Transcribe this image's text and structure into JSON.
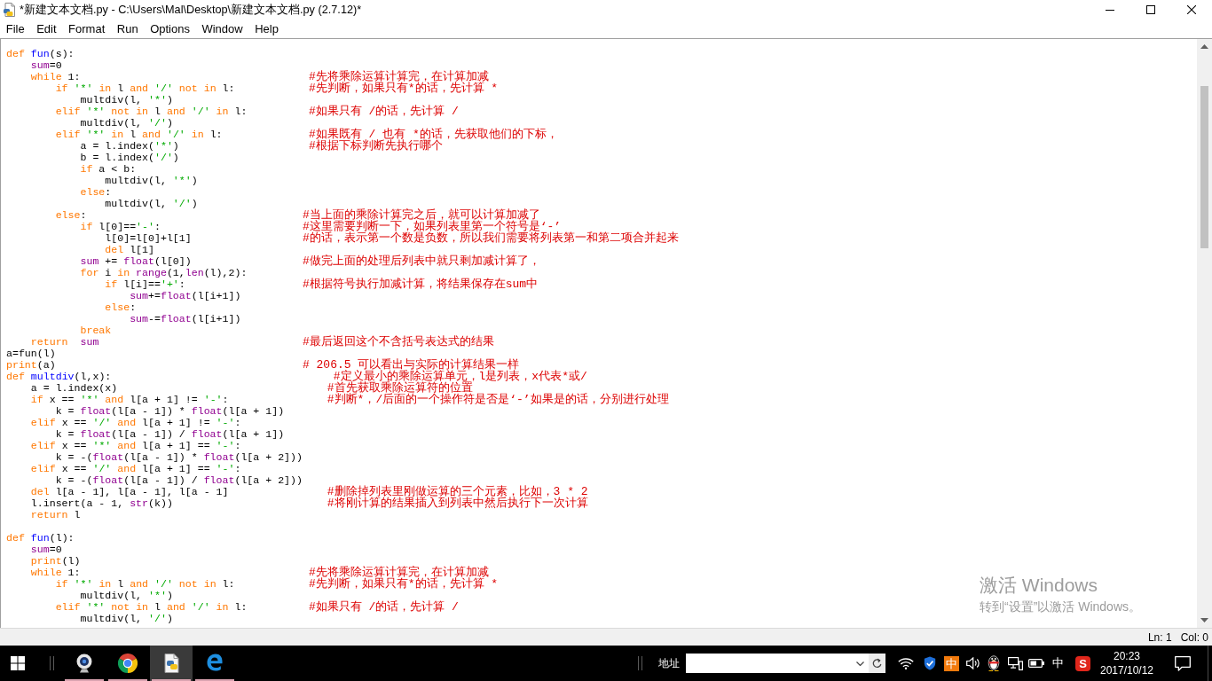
{
  "window": {
    "title": "*新建文本文档.py - C:\\Users\\Mal\\Desktop\\新建文本文档.py (2.7.12)*"
  },
  "menu": [
    "File",
    "Edit",
    "Format",
    "Run",
    "Options",
    "Window",
    "Help"
  ],
  "editor": {
    "lines": [
      {
        "kind": "code",
        "tokens": [
          {
            "kind": "keyword",
            "text": "def "
          },
          {
            "kind": "definition",
            "text": "fun"
          },
          {
            "kind": "plain",
            "text": "(s):"
          }
        ],
        "children": [
          {
            "tokens": [
              {
                "kind": "builtin",
                "text": "sum"
              },
              {
                "kind": "plain",
                "text": "=0"
              }
            ]
          },
          {
            "tokens": [
              {
                "kind": "keyword",
                "text": "while"
              },
              {
                "kind": "plain",
                "text": " 1:"
              }
            ],
            "comment": "#先将乘除运算计算完，在计算加减",
            "children": [
              {
                "tokens": [
                  {
                    "kind": "keyword",
                    "text": "if "
                  },
                  {
                    "kind": "string",
                    "text": "'*' "
                  },
                  {
                    "kind": "keyword",
                    "text": "in"
                  },
                  {
                    "kind": "plain",
                    "text": " l "
                  },
                  {
                    "kind": "keyword",
                    "text": "and "
                  },
                  {
                    "kind": "string",
                    "text": "'/' "
                  },
                  {
                    "kind": "keyword",
                    "text": "not in"
                  },
                  {
                    "kind": "plain",
                    "text": " l:"
                  }
                ],
                "comment": "#先判断，如果只有*的话，先计算 *",
                "children": [
                  {
                    "tokens": [
                      {
                        "kind": "plain",
                        "text": "multdiv(l, "
                      },
                      {
                        "kind": "string",
                        "text": "'*'"
                      },
                      {
                        "kind": "plain",
                        "text": ")"
                      }
                    ]
                  }
                ]
              },
              {
                "tokens": [
                  {
                    "kind": "keyword",
                    "text": "elif "
                  },
                  {
                    "kind": "string",
                    "text": "'*' "
                  },
                  {
                    "kind": "keyword",
                    "text": "not in"
                  },
                  {
                    "kind": "plain",
                    "text": " l "
                  },
                  {
                    "kind": "keyword",
                    "text": "and "
                  },
                  {
                    "kind": "string",
                    "text": "'/' "
                  },
                  {
                    "kind": "keyword",
                    "text": "in"
                  },
                  {
                    "kind": "plain",
                    "text": " l:"
                  }
                ],
                "comment": "#如果只有 /的话，先计算 /",
                "children": [
                  {
                    "tokens": [
                      {
                        "kind": "plain",
                        "text": "multdiv(l, "
                      },
                      {
                        "kind": "string",
                        "text": "'/'"
                      },
                      {
                        "kind": "plain",
                        "text": ")"
                      }
                    ]
                  }
                ]
              },
              {
                "tokens": [
                  {
                    "kind": "keyword",
                    "text": "elif "
                  },
                  {
                    "kind": "string",
                    "text": "'*' "
                  },
                  {
                    "kind": "keyword",
                    "text": "in"
                  },
                  {
                    "kind": "plain",
                    "text": " l "
                  },
                  {
                    "kind": "keyword",
                    "text": "and "
                  },
                  {
                    "kind": "string",
                    "text": "'/' "
                  },
                  {
                    "kind": "keyword",
                    "text": "in"
                  },
                  {
                    "kind": "plain",
                    "text": " l:"
                  }
                ],
                "comment": "#如果既有 / 也有 *的话，先获取他们的下标，",
                "children": [
                  {
                    "tokens": [
                      {
                        "kind": "plain",
                        "text": "a = l.index("
                      },
                      {
                        "kind": "string",
                        "text": "'*'"
                      },
                      {
                        "kind": "plain",
                        "text": ")"
                      }
                    ],
                    "comment": "#根据下标判断先执行哪个"
                  },
                  {
                    "tokens": [
                      {
                        "kind": "plain",
                        "text": "b = l.index("
                      },
                      {
                        "kind": "string",
                        "text": "'/'"
                      },
                      {
                        "kind": "plain",
                        "text": ")"
                      }
                    ]
                  },
                  {
                    "tokens": [
                      {
                        "kind": "keyword",
                        "text": "if"
                      },
                      {
                        "kind": "plain",
                        "text": " a < b:"
                      }
                    ],
                    "children": [
                      {
                        "tokens": [
                          {
                            "kind": "plain",
                            "text": "multdiv(l, "
                          },
                          {
                            "kind": "string",
                            "text": "'*'"
                          },
                          {
                            "kind": "plain",
                            "text": ")"
                          }
                        ]
                      }
                    ]
                  },
                  {
                    "tokens": [
                      {
                        "kind": "keyword",
                        "text": "else"
                      },
                      {
                        "kind": "plain",
                        "text": ":"
                      }
                    ],
                    "children": [
                      {
                        "tokens": [
                          {
                            "kind": "plain",
                            "text": "multdiv(l, "
                          },
                          {
                            "kind": "string",
                            "text": "'/'"
                          },
                          {
                            "kind": "plain",
                            "text": ")"
                          }
                        ]
                      }
                    ]
                  }
                ]
              },
              {
                "tokens": [
                  {
                    "kind": "keyword",
                    "text": "else"
                  },
                  {
                    "kind": "plain",
                    "text": ":"
                  }
                ],
                "comment": "#当上面的乘除计算完之后，就可以计算加减了",
                "children": [
                  {
                    "tokens": [
                      {
                        "kind": "keyword",
                        "text": "if"
                      },
                      {
                        "kind": "plain",
                        "text": " l[0]=="
                      },
                      {
                        "kind": "string",
                        "text": "'-'"
                      },
                      {
                        "kind": "plain",
                        "text": ":"
                      }
                    ],
                    "comment": "#这里需要判断一下，如果列表里第一个符号是‘-’",
                    "children": [
                      {
                        "tokens": [
                          {
                            "kind": "plain",
                            "text": "l[0]=l[0]+l[1]"
                          }
                        ],
                        "comment": "#的话，表示第一个数是负数，所以我们需要将列表第一和第二项合并起来"
                      },
                      {
                        "tokens": [
                          {
                            "kind": "keyword",
                            "text": "del"
                          },
                          {
                            "kind": "plain",
                            "text": " l[1]"
                          }
                        ]
                      }
                    ]
                  },
                  {
                    "tokens": [
                      {
                        "kind": "builtin",
                        "text": "sum"
                      },
                      {
                        "kind": "plain",
                        "text": " += "
                      },
                      {
                        "kind": "builtin",
                        "text": "float"
                      },
                      {
                        "kind": "plain",
                        "text": "(l[0])"
                      }
                    ],
                    "comment": "#做完上面的处理后列表中就只剩加减计算了，"
                  },
                  {
                    "tokens": [
                      {
                        "kind": "keyword",
                        "text": "for"
                      },
                      {
                        "kind": "plain",
                        "text": " i "
                      },
                      {
                        "kind": "keyword",
                        "text": "in "
                      },
                      {
                        "kind": "builtin",
                        "text": "range"
                      },
                      {
                        "kind": "plain",
                        "text": "(1,"
                      },
                      {
                        "kind": "builtin",
                        "text": "len"
                      },
                      {
                        "kind": "plain",
                        "text": "(l),2):"
                      }
                    ],
                    "children": [
                      {
                        "tokens": [
                          {
                            "kind": "keyword",
                            "text": "if"
                          },
                          {
                            "kind": "plain",
                            "text": " l[i]=="
                          },
                          {
                            "kind": "string",
                            "text": "'+'"
                          },
                          {
                            "kind": "plain",
                            "text": ":"
                          }
                        ],
                        "comment": "#根据符号执行加减计算，将结果保存在sum中",
                        "children": [
                          {
                            "tokens": [
                              {
                                "kind": "builtin",
                                "text": "sum"
                              },
                              {
                                "kind": "plain",
                                "text": "+="
                              },
                              {
                                "kind": "builtin",
                                "text": "float"
                              },
                              {
                                "kind": "plain",
                                "text": "(l[i+1])"
                              }
                            ]
                          }
                        ]
                      },
                      {
                        "tokens": [
                          {
                            "kind": "keyword",
                            "text": "else"
                          },
                          {
                            "kind": "plain",
                            "text": ":"
                          }
                        ],
                        "children": [
                          {
                            "tokens": [
                              {
                                "kind": "builtin",
                                "text": "sum"
                              },
                              {
                                "kind": "plain",
                                "text": "-="
                              },
                              {
                                "kind": "builtin",
                                "text": "float"
                              },
                              {
                                "kind": "plain",
                                "text": "(l[i+1])"
                              }
                            ]
                          }
                        ]
                      }
                    ]
                  },
                  {
                    "tokens": [
                      {
                        "kind": "keyword",
                        "text": "break"
                      }
                    ]
                  }
                ]
              }
            ]
          },
          {
            "tokens": [
              {
                "kind": "keyword",
                "text": "return  "
              },
              {
                "kind": "builtin",
                "text": "sum"
              }
            ],
            "comment": "#最后返回这个不含括号表达式的结果"
          }
        ]
      },
      {
        "kind": "code",
        "tokens": [
          {
            "kind": "plain",
            "text": "a=fun(l)"
          }
        ]
      },
      {
        "kind": "code",
        "tokens": [
          {
            "kind": "keyword",
            "text": "print"
          },
          {
            "kind": "plain",
            "text": "(a)"
          }
        ],
        "comment": "# 206.5 可以看出与实际的计算结果一样"
      },
      {
        "kind": "code",
        "tokens": [
          {
            "kind": "keyword",
            "text": "def "
          },
          {
            "kind": "definition",
            "text": "multdiv"
          },
          {
            "kind": "plain",
            "text": "(l,x):"
          }
        ],
        "comment": "#定义最小的乘除运算单元，l是列表，x代表*或/",
        "children": [
          {
            "tokens": [
              {
                "kind": "plain",
                "text": "a = l.index(x)"
              }
            ],
            "comment": "#首先获取乘除运算符的位置"
          },
          {
            "tokens": [
              {
                "kind": "keyword",
                "text": "if"
              },
              {
                "kind": "plain",
                "text": " x == "
              },
              {
                "kind": "string",
                "text": "'*' "
              },
              {
                "kind": "keyword",
                "text": "and"
              },
              {
                "kind": "plain",
                "text": " l[a + 1] != "
              },
              {
                "kind": "string",
                "text": "'-'"
              },
              {
                "kind": "plain",
                "text": ":"
              }
            ],
            "comment": "#判断*，/后面的一个操作符是否是‘-’如果是的话，分别进行处理",
            "children": [
              {
                "tokens": [
                  {
                    "kind": "plain",
                    "text": "k = "
                  },
                  {
                    "kind": "builtin",
                    "text": "float"
                  },
                  {
                    "kind": "plain",
                    "text": "(l[a - 1]) * "
                  },
                  {
                    "kind": "builtin",
                    "text": "float"
                  },
                  {
                    "kind": "plain",
                    "text": "(l[a + 1])"
                  }
                ]
              }
            ]
          },
          {
            "tokens": [
              {
                "kind": "keyword",
                "text": "elif"
              },
              {
                "kind": "plain",
                "text": " x == "
              },
              {
                "kind": "string",
                "text": "'/' "
              },
              {
                "kind": "keyword",
                "text": "and"
              },
              {
                "kind": "plain",
                "text": " l[a + 1] != "
              },
              {
                "kind": "string",
                "text": "'-'"
              },
              {
                "kind": "plain",
                "text": ":"
              }
            ],
            "children": [
              {
                "tokens": [
                  {
                    "kind": "plain",
                    "text": "k = "
                  },
                  {
                    "kind": "builtin",
                    "text": "float"
                  },
                  {
                    "kind": "plain",
                    "text": "(l[a - 1]) / "
                  },
                  {
                    "kind": "builtin",
                    "text": "float"
                  },
                  {
                    "kind": "plain",
                    "text": "(l[a + 1])"
                  }
                ]
              }
            ]
          },
          {
            "tokens": [
              {
                "kind": "keyword",
                "text": "elif"
              },
              {
                "kind": "plain",
                "text": " x == "
              },
              {
                "kind": "string",
                "text": "'*' "
              },
              {
                "kind": "keyword",
                "text": "and"
              },
              {
                "kind": "plain",
                "text": " l[a + 1] == "
              },
              {
                "kind": "string",
                "text": "'-'"
              },
              {
                "kind": "plain",
                "text": ":"
              }
            ],
            "children": [
              {
                "tokens": [
                  {
                    "kind": "plain",
                    "text": "k = -("
                  },
                  {
                    "kind": "builtin",
                    "text": "float"
                  },
                  {
                    "kind": "plain",
                    "text": "(l[a - 1]) * "
                  },
                  {
                    "kind": "builtin",
                    "text": "float"
                  },
                  {
                    "kind": "plain",
                    "text": "(l[a + 2]))"
                  }
                ]
              }
            ]
          },
          {
            "tokens": [
              {
                "kind": "keyword",
                "text": "elif"
              },
              {
                "kind": "plain",
                "text": " x == "
              },
              {
                "kind": "string",
                "text": "'/' "
              },
              {
                "kind": "keyword",
                "text": "and"
              },
              {
                "kind": "plain",
                "text": " l[a + 1] == "
              },
              {
                "kind": "string",
                "text": "'-'"
              },
              {
                "kind": "plain",
                "text": ":"
              }
            ],
            "children": [
              {
                "tokens": [
                  {
                    "kind": "plain",
                    "text": "k = -("
                  },
                  {
                    "kind": "builtin",
                    "text": "float"
                  },
                  {
                    "kind": "plain",
                    "text": "(l[a - 1]) / "
                  },
                  {
                    "kind": "builtin",
                    "text": "float"
                  },
                  {
                    "kind": "plain",
                    "text": "(l[a + 2]))"
                  }
                ]
              }
            ]
          },
          {
            "tokens": [
              {
                "kind": "keyword",
                "text": "del"
              },
              {
                "kind": "plain",
                "text": " l[a - 1], l[a - 1], l[a - 1]"
              }
            ],
            "comment": "#删除掉列表里刚做运算的三个元素，比如，3 * 2"
          },
          {
            "tokens": [
              {
                "kind": "plain",
                "text": "l.insert(a - 1, "
              },
              {
                "kind": "builtin",
                "text": "str"
              },
              {
                "kind": "plain",
                "text": "(k))"
              }
            ],
            "comment": "#将刚计算的结果插入到列表中然后执行下一次计算"
          },
          {
            "tokens": [
              {
                "kind": "keyword",
                "text": "return"
              },
              {
                "kind": "plain",
                "text": " l"
              }
            ]
          }
        ]
      },
      {
        "kind": "blank"
      },
      {
        "kind": "code",
        "tokens": [
          {
            "kind": "keyword",
            "text": "def "
          },
          {
            "kind": "definition",
            "text": "fun"
          },
          {
            "kind": "plain",
            "text": "(l):"
          }
        ],
        "children": [
          {
            "tokens": [
              {
                "kind": "builtin",
                "text": "sum"
              },
              {
                "kind": "plain",
                "text": "=0"
              }
            ]
          },
          {
            "tokens": [
              {
                "kind": "keyword",
                "text": "print"
              },
              {
                "kind": "plain",
                "text": "(l)"
              }
            ]
          },
          {
            "tokens": [
              {
                "kind": "keyword",
                "text": "while"
              },
              {
                "kind": "plain",
                "text": " 1:"
              }
            ],
            "comment": "#先将乘除运算计算完，在计算加减",
            "children": [
              {
                "tokens": [
                  {
                    "kind": "keyword",
                    "text": "if "
                  },
                  {
                    "kind": "string",
                    "text": "'*' "
                  },
                  {
                    "kind": "keyword",
                    "text": "in"
                  },
                  {
                    "kind": "plain",
                    "text": " l "
                  },
                  {
                    "kind": "keyword",
                    "text": "and "
                  },
                  {
                    "kind": "string",
                    "text": "'/' "
                  },
                  {
                    "kind": "keyword",
                    "text": "not in"
                  },
                  {
                    "kind": "plain",
                    "text": " l:"
                  }
                ],
                "comment": "#先判断，如果只有*的话，先计算 *",
                "children": [
                  {
                    "tokens": [
                      {
                        "kind": "plain",
                        "text": "multdiv(l, "
                      },
                      {
                        "kind": "string",
                        "text": "'*'"
                      },
                      {
                        "kind": "plain",
                        "text": ")"
                      }
                    ]
                  }
                ]
              },
              {
                "tokens": [
                  {
                    "kind": "keyword",
                    "text": "elif "
                  },
                  {
                    "kind": "string",
                    "text": "'*' "
                  },
                  {
                    "kind": "keyword",
                    "text": "not in"
                  },
                  {
                    "kind": "plain",
                    "text": " l "
                  },
                  {
                    "kind": "keyword",
                    "text": "and "
                  },
                  {
                    "kind": "string",
                    "text": "'/' "
                  },
                  {
                    "kind": "keyword",
                    "text": "in"
                  },
                  {
                    "kind": "plain",
                    "text": " l:"
                  }
                ],
                "comment": "#如果只有 /的话，先计算 /",
                "children": [
                  {
                    "tokens": [
                      {
                        "kind": "plain",
                        "text": "multdiv(l, "
                      },
                      {
                        "kind": "string",
                        "text": "'/'"
                      },
                      {
                        "kind": "plain",
                        "text": ")"
                      }
                    ]
                  }
                ]
              }
            ]
          }
        ]
      }
    ]
  },
  "activation_notice": {
    "title": "激活 Windows",
    "message": "转到“设置”以激活 Windows。"
  },
  "status_bar": {
    "line": "Ln: 1",
    "column": "Col: 0"
  },
  "taskbar": {
    "apps": [
      {
        "kind": "camera",
        "running": true,
        "selected": false
      },
      {
        "kind": "chrome",
        "running": true,
        "selected": false
      },
      {
        "kind": "python",
        "running": true,
        "selected": true
      },
      {
        "kind": "edge",
        "running": true,
        "selected": false
      }
    ],
    "address_label": "地址",
    "input_method": "中",
    "language": "中",
    "tray_logo": "S",
    "time": "20:23",
    "date": "2017/10/12"
  }
}
